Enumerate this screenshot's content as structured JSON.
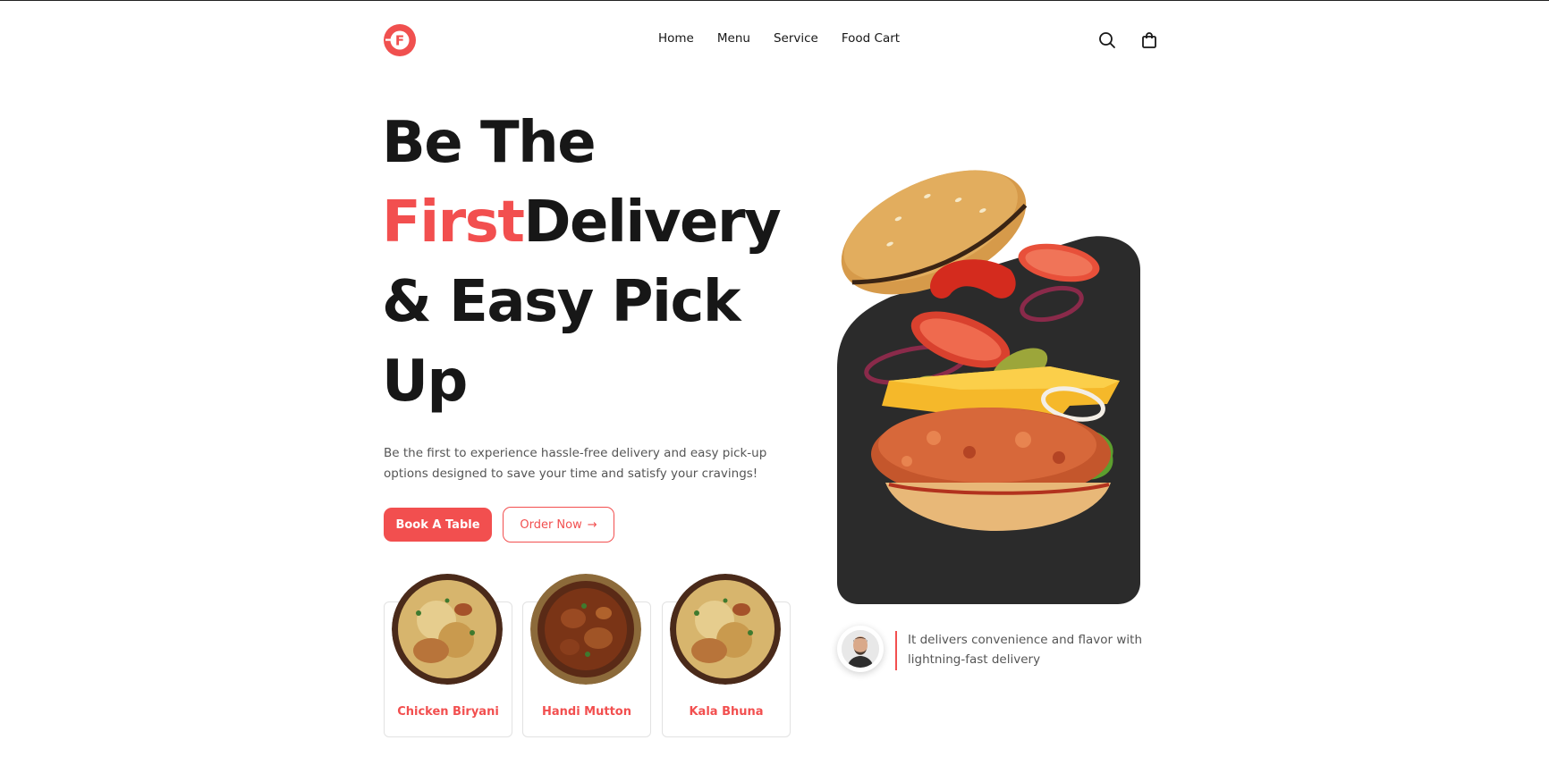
{
  "brand": {
    "logo_text": "F",
    "accent_color": "#f24f4f",
    "dark_panel_color": "#2b2b2b"
  },
  "nav": {
    "items": [
      {
        "label": "Home"
      },
      {
        "label": "Menu"
      },
      {
        "label": "Service"
      },
      {
        "label": "Food Cart"
      }
    ]
  },
  "header_icons": [
    "search-icon",
    "shopping-bag-icon"
  ],
  "hero": {
    "line1": "Be The",
    "line2_accent": "First",
    "line2_rest": "Delivery",
    "line3": "& Easy Pick",
    "line4": "Up",
    "description": "Be the first to experience hassle-free delivery and easy pick-up options designed to save your time and satisfy your cravings!",
    "primary_button": "Book A Table",
    "secondary_button": "Order Now",
    "secondary_button_icon": "→"
  },
  "dishes": [
    {
      "name": "Chicken Biryani"
    },
    {
      "name": "Handi Mutton"
    },
    {
      "name": "Kala Bhuna"
    }
  ],
  "testimonial": {
    "text": "It delivers convenience and flavor with lightning-fast delivery"
  }
}
